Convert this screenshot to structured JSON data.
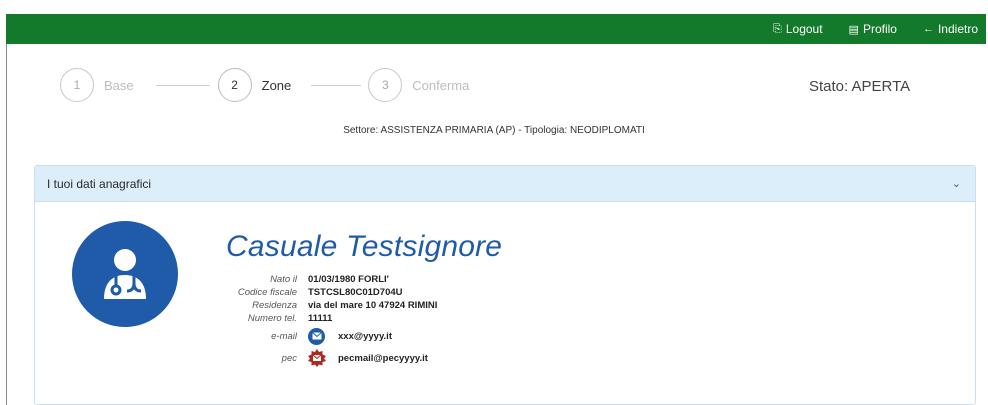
{
  "topbar": {
    "logout_label": "Logout",
    "profilo_label": "Profilo",
    "indietro_label": "Indietro",
    "color": "#137a2b"
  },
  "steps": [
    {
      "num": "1",
      "label": "Base",
      "active": false
    },
    {
      "num": "2",
      "label": "Zone",
      "active": true
    },
    {
      "num": "3",
      "label": "Conferma",
      "active": false
    }
  ],
  "stato": "Stato: APERTA",
  "settore": "Settore: ASSISTENZA PRIMARIA (AP) - Tipologia: NEODIPLOMATI",
  "panel": {
    "title": "I tuoi dati anagrafici",
    "accent": "#dceefa"
  },
  "profile": {
    "name": "Casuale Testsignore",
    "avatar_icon": "doctor-icon",
    "nato_label": "Nato il",
    "nato_value": "01/03/1980 FORLI'",
    "cf_label": "Codice fiscale",
    "cf_value": "TSTCSL80C01D704U",
    "residenza_label": "Residenza",
    "residenza_value": "via del mare 10 47924 RIMINI",
    "tel_label": "Numero tel.",
    "tel_value": "11111",
    "email_label": "e-mail",
    "email_value": "xxx@yyyy.it",
    "pec_label": "pec",
    "pec_value": "pecmail@pecyyyy.it",
    "brand_color": "#1f5ba8"
  }
}
